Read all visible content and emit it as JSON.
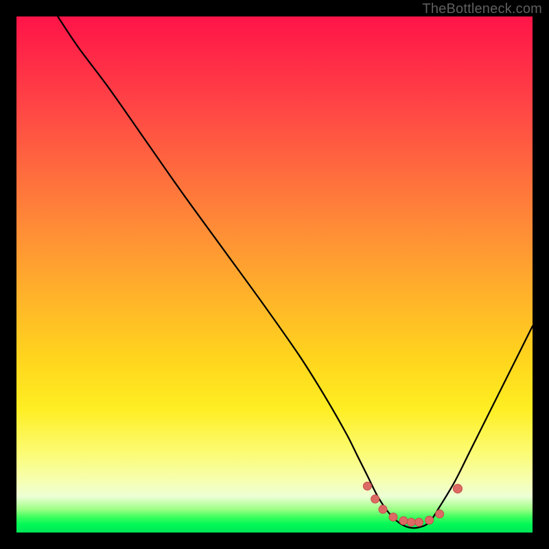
{
  "watermark": "TheBottleneck.com",
  "colors": {
    "black": "#000000",
    "curve": "#000000",
    "marker_fill": "#dc6a64",
    "marker_stroke": "#c24e48"
  },
  "chart_data": {
    "type": "line",
    "title": "",
    "xlabel": "",
    "ylabel": "",
    "xlim": [
      0,
      100
    ],
    "ylim": [
      0,
      100
    ],
    "grid": false,
    "legend": false,
    "series": [
      {
        "name": "bottleneck-curve",
        "comment": "x in 0–100; y in 0–100; visually read from gradient/curve. Minimum (~0) around x≈74–80.",
        "x": [
          8,
          12,
          18,
          25,
          32,
          40,
          48,
          55,
          60,
          64,
          66,
          68,
          70,
          72,
          74,
          76,
          78,
          80,
          82,
          85,
          88,
          92,
          96,
          100
        ],
        "y": [
          100,
          94,
          86,
          76,
          66,
          55,
          44,
          34,
          26,
          19,
          15,
          11,
          7,
          4,
          2,
          1,
          1,
          2,
          5,
          10,
          16,
          24,
          32,
          40
        ]
      }
    ],
    "markers": {
      "name": "trough-markers",
      "comment": "Salmon-colored dots near the valley of the curve",
      "points": [
        {
          "x": 68.0,
          "y": 9.0
        },
        {
          "x": 69.5,
          "y": 6.5
        },
        {
          "x": 71.0,
          "y": 4.5
        },
        {
          "x": 73.0,
          "y": 3.0
        },
        {
          "x": 75.0,
          "y": 2.3
        },
        {
          "x": 76.5,
          "y": 2.0
        },
        {
          "x": 78.0,
          "y": 2.0
        },
        {
          "x": 80.0,
          "y": 2.4
        },
        {
          "x": 82.0,
          "y": 3.6
        },
        {
          "x": 85.5,
          "y": 8.5
        }
      ]
    }
  }
}
